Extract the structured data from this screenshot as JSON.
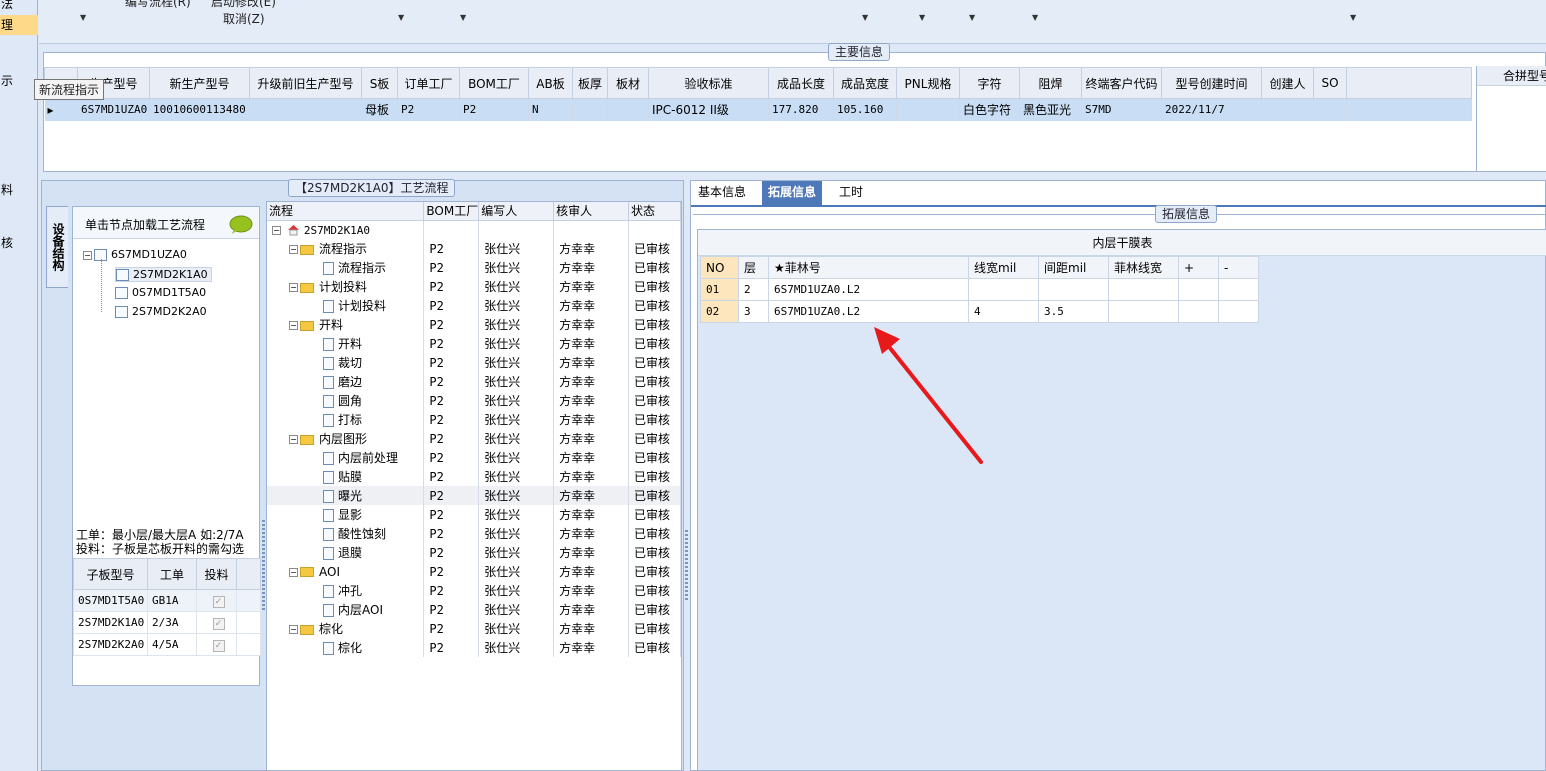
{
  "left_nav": {
    "items": [
      "法",
      "理",
      "示",
      "",
      "料",
      "核"
    ]
  },
  "toolbar": {
    "item1": "编写流程(R)",
    "item2": "启动修改(E)",
    "item3": "取消(Z)"
  },
  "tooltip": "新流程指示",
  "main_info": {
    "title": "主要信息",
    "columns": [
      "",
      "生产型号",
      "新生产型号",
      "升级前旧生产型号",
      "S板",
      "订单工厂",
      "BOM工厂",
      "AB板",
      "板厚",
      "板材",
      "验收标准",
      "成品长度",
      "成品宽度",
      "PNL规格",
      "字符",
      "阻焊",
      "终端客户代码",
      "型号创建时间",
      "创建人",
      "SO",
      ""
    ],
    "rows": [
      [
        "▸",
        "6S7MD1UZA0",
        "10010600113480",
        "",
        "母板",
        "P2",
        "P2",
        "N",
        "",
        "",
        "IPC-6012 II级",
        "177.820",
        "105.160",
        "",
        "白色字符",
        "黑色亚光",
        "S7MD",
        "2022/11/7",
        "",
        "",
        ""
      ]
    ]
  },
  "merge_panel": {
    "title": "合拼型号"
  },
  "process": {
    "title": "【2S7MD2K1A0】工艺流程",
    "vertical_tab": "设备结构",
    "load_hint": "单击节点加载工艺流程",
    "device_tree": {
      "root": "6S7MD1UZA0",
      "children": [
        "2S7MD2K1A0",
        "0S7MD1T5A0",
        "2S7MD2K2A0"
      ]
    },
    "hint_line1": "工单：最小层/最大层A 如:2/7A",
    "hint_line2": "投料：子板是芯板开料的需勾选",
    "sub_table": {
      "columns": [
        "子板型号",
        "工单",
        "投料"
      ],
      "rows": [
        [
          "0S7MD1T5A0",
          "GB1A",
          true
        ],
        [
          "2S7MD2K1A0",
          "2/3A",
          true
        ],
        [
          "2S7MD2K2A0",
          "4/5A",
          true
        ]
      ]
    },
    "flow_table": {
      "columns": [
        "流程",
        "BOM工厂",
        "编写人",
        "核审人",
        "状态"
      ],
      "root": "2S7MD2K1A0",
      "rows": [
        {
          "name": "流程指示",
          "level": 1,
          "type": "folder",
          "bom": "P2",
          "writer": "张仕兴",
          "reviewer": "方幸幸",
          "status": "已审核"
        },
        {
          "name": "流程指示",
          "level": 2,
          "type": "file",
          "bom": "P2",
          "writer": "张仕兴",
          "reviewer": "方幸幸",
          "status": "已审核"
        },
        {
          "name": "计划投料",
          "level": 1,
          "type": "folder",
          "bom": "P2",
          "writer": "张仕兴",
          "reviewer": "方幸幸",
          "status": "已审核"
        },
        {
          "name": "计划投料",
          "level": 2,
          "type": "file",
          "bom": "P2",
          "writer": "张仕兴",
          "reviewer": "方幸幸",
          "status": "已审核"
        },
        {
          "name": "开料",
          "level": 1,
          "type": "folder",
          "bom": "P2",
          "writer": "张仕兴",
          "reviewer": "方幸幸",
          "status": "已审核"
        },
        {
          "name": "开料",
          "level": 2,
          "type": "file",
          "bom": "P2",
          "writer": "张仕兴",
          "reviewer": "方幸幸",
          "status": "已审核"
        },
        {
          "name": "裁切",
          "level": 2,
          "type": "file",
          "bom": "P2",
          "writer": "张仕兴",
          "reviewer": "方幸幸",
          "status": "已审核"
        },
        {
          "name": "磨边",
          "level": 2,
          "type": "file",
          "bom": "P2",
          "writer": "张仕兴",
          "reviewer": "方幸幸",
          "status": "已审核"
        },
        {
          "name": "圆角",
          "level": 2,
          "type": "file",
          "bom": "P2",
          "writer": "张仕兴",
          "reviewer": "方幸幸",
          "status": "已审核"
        },
        {
          "name": "打标",
          "level": 2,
          "type": "file",
          "bom": "P2",
          "writer": "张仕兴",
          "reviewer": "方幸幸",
          "status": "已审核"
        },
        {
          "name": "内层图形",
          "level": 1,
          "type": "folder",
          "bom": "P2",
          "writer": "张仕兴",
          "reviewer": "方幸幸",
          "status": "已审核"
        },
        {
          "name": "内层前处理",
          "level": 2,
          "type": "file",
          "bom": "P2",
          "writer": "张仕兴",
          "reviewer": "方幸幸",
          "status": "已审核"
        },
        {
          "name": "贴膜",
          "level": 2,
          "type": "file",
          "bom": "P2",
          "writer": "张仕兴",
          "reviewer": "方幸幸",
          "status": "已审核"
        },
        {
          "name": "曝光",
          "level": 2,
          "type": "file",
          "bom": "P2",
          "writer": "张仕兴",
          "reviewer": "方幸幸",
          "status": "已审核",
          "hl": true
        },
        {
          "name": "显影",
          "level": 2,
          "type": "file",
          "bom": "P2",
          "writer": "张仕兴",
          "reviewer": "方幸幸",
          "status": "已审核"
        },
        {
          "name": "酸性蚀刻",
          "level": 2,
          "type": "file",
          "bom": "P2",
          "writer": "张仕兴",
          "reviewer": "方幸幸",
          "status": "已审核"
        },
        {
          "name": "退膜",
          "level": 2,
          "type": "file",
          "bom": "P2",
          "writer": "张仕兴",
          "reviewer": "方幸幸",
          "status": "已审核"
        },
        {
          "name": "AOI",
          "level": 1,
          "type": "folder",
          "bom": "P2",
          "writer": "张仕兴",
          "reviewer": "方幸幸",
          "status": "已审核"
        },
        {
          "name": "冲孔",
          "level": 2,
          "type": "file",
          "bom": "P2",
          "writer": "张仕兴",
          "reviewer": "方幸幸",
          "status": "已审核"
        },
        {
          "name": "内层AOI",
          "level": 2,
          "type": "file",
          "bom": "P2",
          "writer": "张仕兴",
          "reviewer": "方幸幸",
          "status": "已审核"
        },
        {
          "name": "棕化",
          "level": 1,
          "type": "folder",
          "bom": "P2",
          "writer": "张仕兴",
          "reviewer": "方幸幸",
          "status": "已审核"
        },
        {
          "name": "棕化",
          "level": 2,
          "type": "file",
          "bom": "P2",
          "writer": "张仕兴",
          "reviewer": "方幸幸",
          "status": "已审核"
        }
      ]
    }
  },
  "right": {
    "tabs": [
      "基本信息",
      "拓展信息",
      "工时"
    ],
    "active_tab": "拓展信息",
    "section_title": "拓展信息",
    "table_title": "内层干膜表",
    "columns": [
      "NO",
      "层",
      "★菲林号",
      "线宽mil",
      "间距mil",
      "菲林线宽",
      "+",
      "-"
    ],
    "rows": [
      [
        "01",
        "2",
        "6S7MD1UZA0.L2",
        "",
        "",
        "",
        "",
        ""
      ],
      [
        "02",
        "3",
        "6S7MD1UZA0.L2",
        "4",
        "3.5",
        "",
        "",
        ""
      ]
    ]
  },
  "colors": {
    "accent": "#4f78b8",
    "selected_row": "#c9def5",
    "arrow": "#e8191b",
    "highlight_nav": "#ffd98a"
  }
}
